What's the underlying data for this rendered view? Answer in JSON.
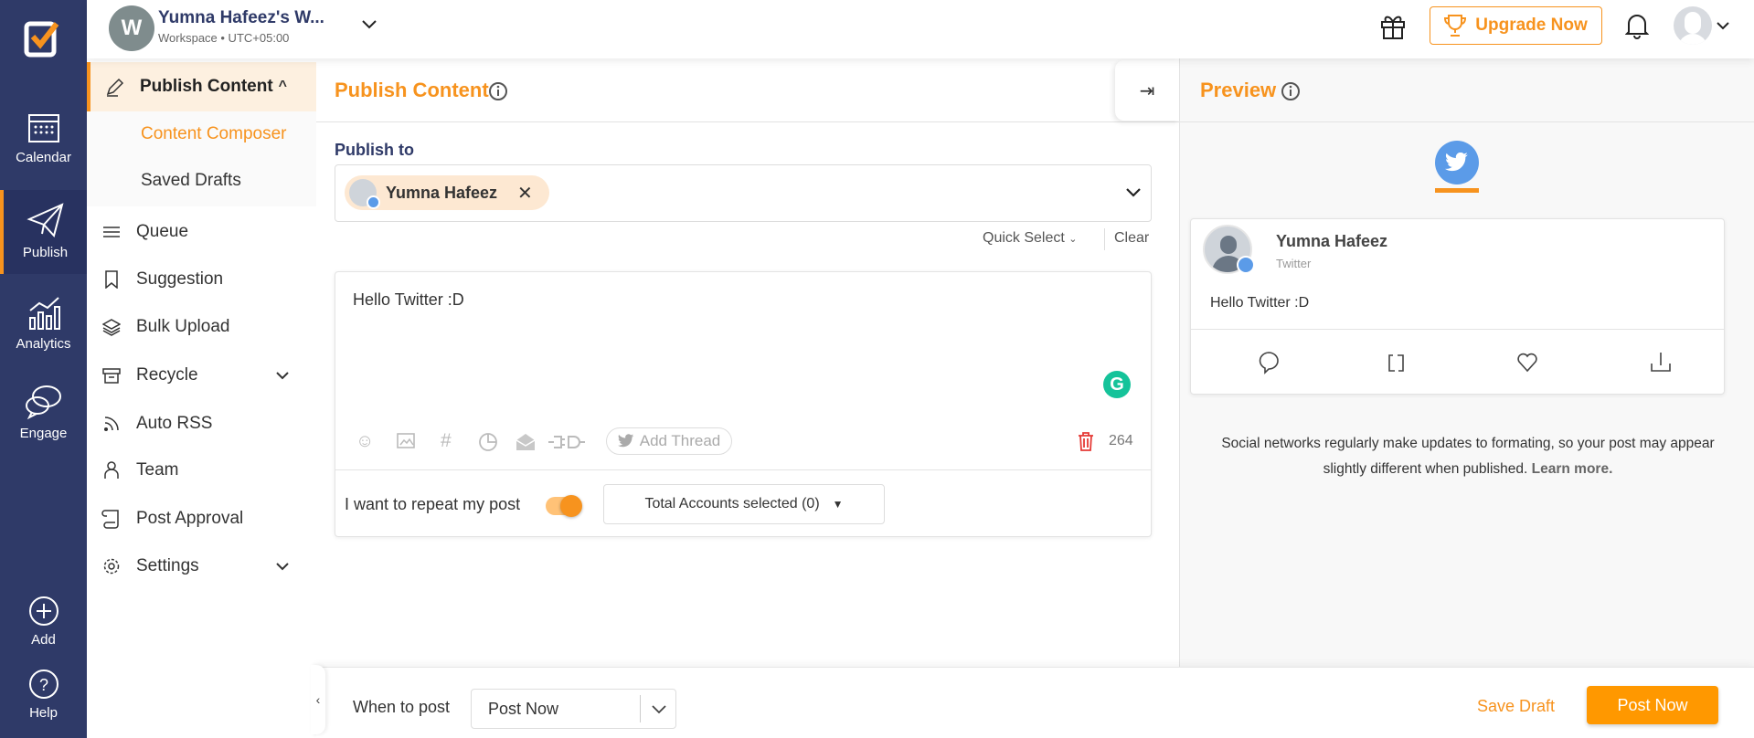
{
  "colors": {
    "accent": "#f7931e",
    "rail": "#2f3a68",
    "twitter": "#5b9be8",
    "danger": "#e53935",
    "grammarly": "#15c39a"
  },
  "rail": {
    "items": [
      {
        "label": "Calendar",
        "icon": "calendar-icon"
      },
      {
        "label": "Publish",
        "icon": "paper-plane-icon",
        "active": true
      },
      {
        "label": "Analytics",
        "icon": "analytics-icon"
      },
      {
        "label": "Engage",
        "icon": "chat-icon"
      },
      {
        "label": "Add",
        "icon": "plus-circle-icon"
      },
      {
        "label": "Help",
        "icon": "question-circle-icon"
      }
    ]
  },
  "header": {
    "workspace_initial": "W",
    "workspace_name": "Yumna Hafeez's W...",
    "workspace_sub": "Workspace • UTC+05:00",
    "upgrade_label": "Upgrade Now"
  },
  "sidebar": {
    "section": "Publish Content",
    "sub_items": [
      {
        "label": "Content Composer",
        "active": true
      },
      {
        "label": "Saved Drafts"
      }
    ],
    "items": [
      {
        "label": "Queue"
      },
      {
        "label": "Suggestion"
      },
      {
        "label": "Bulk Upload"
      },
      {
        "label": "Recycle"
      },
      {
        "label": "Auto RSS"
      },
      {
        "label": "Team"
      },
      {
        "label": "Post Approval"
      },
      {
        "label": "Settings"
      }
    ]
  },
  "composer": {
    "title": "Publish Content",
    "publish_to_label": "Publish to",
    "account_chip": "Yumna Hafeez",
    "quick_select": "Quick Select",
    "clear": "Clear",
    "post_text": "Hello Twitter :D",
    "add_thread": "Add Thread",
    "char_count": "264",
    "repeat_label": "I want to repeat my post",
    "repeat_enabled": true,
    "accounts_dropdown": "Total Accounts selected (0)"
  },
  "preview": {
    "title": "Preview",
    "account_name": "Yumna Hafeez",
    "network": "Twitter",
    "post_text": "Hello Twitter :D",
    "note": "Social networks regularly make updates to formating, so your post may appear slightly different when published.",
    "learn_more": "Learn more."
  },
  "footer": {
    "when_label": "When to post",
    "when_value": "Post Now",
    "save_draft": "Save Draft",
    "post_now": "Post Now"
  }
}
